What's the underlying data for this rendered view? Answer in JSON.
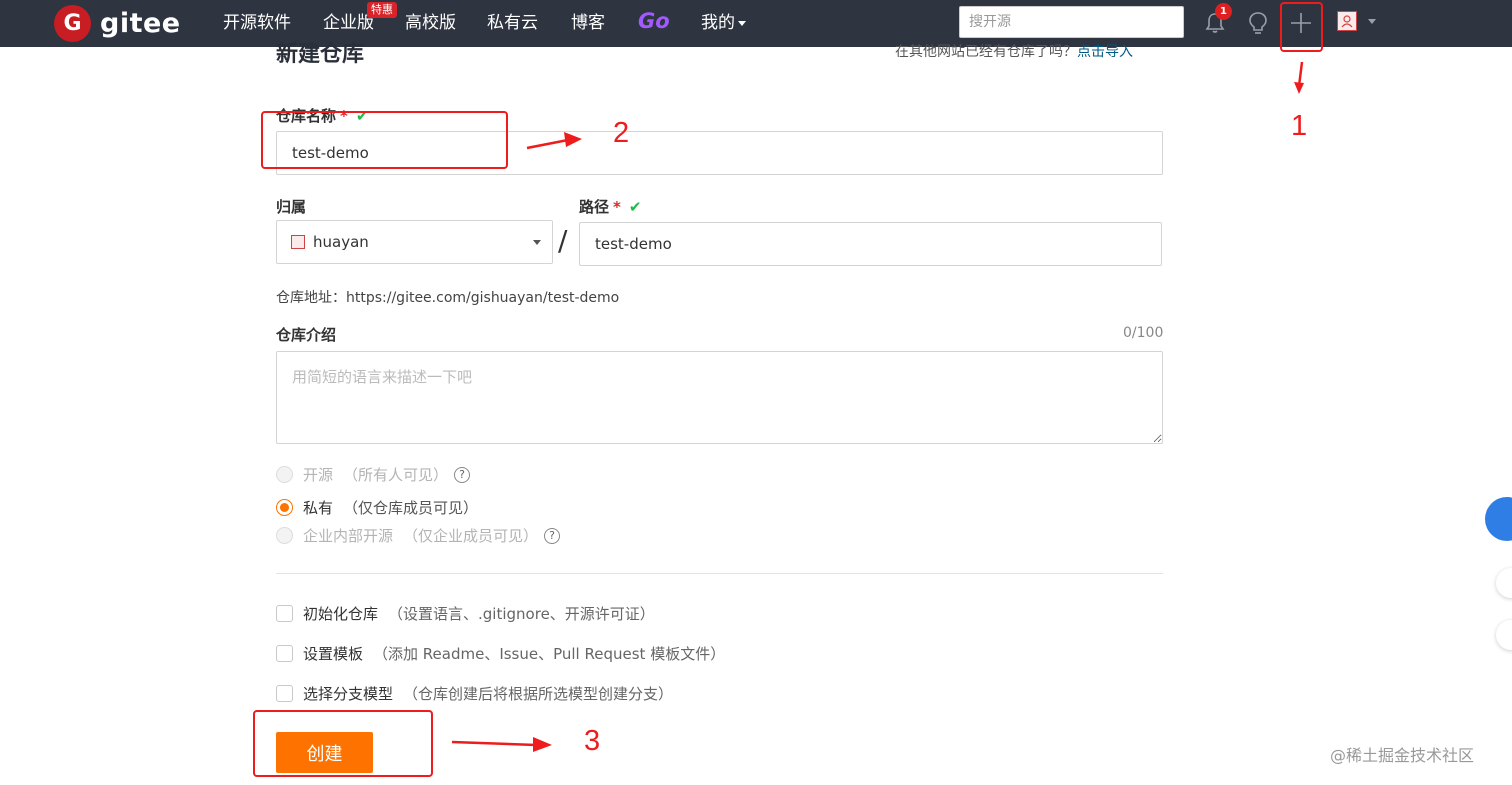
{
  "header": {
    "logo_letter": "G",
    "logo_text": "gitee",
    "nav": [
      {
        "label": "开源软件"
      },
      {
        "label": "企业版"
      },
      {
        "label": "高校版"
      },
      {
        "label": "私有云"
      },
      {
        "label": "博客"
      },
      {
        "label": "Go"
      },
      {
        "label": "我的"
      }
    ],
    "promo_badge": "特惠",
    "search_placeholder": "搜开源",
    "notification_count": "1",
    "icons": [
      "bell-icon",
      "lightbulb-icon",
      "plus-icon",
      "avatar"
    ]
  },
  "form": {
    "title": "新建仓库",
    "import_prompt": "在其他网站已经有仓库了吗？",
    "import_link": "点击导入",
    "repo_name_label": "仓库名称",
    "repo_name_value": "test-demo",
    "owner_label": "归属",
    "owner_value": "huayan",
    "path_label": "路径",
    "path_value": "test-demo",
    "required_mark": "*",
    "repo_url_label": "仓库地址：",
    "repo_url_value": "https://gitee.com/gishuayan/test-demo",
    "intro_label": "仓库介绍",
    "intro_counter": "0/100",
    "intro_placeholder": "用简短的语言来描述一下吧",
    "visibility": [
      {
        "label": "开源",
        "desc": "（所有人可见）",
        "selected": false,
        "disabled": true,
        "help": true
      },
      {
        "label": "私有",
        "desc": "（仅仓库成员可见）",
        "selected": true,
        "disabled": false,
        "help": false
      },
      {
        "label": "企业内部开源",
        "desc": "（仅企业成员可见）",
        "selected": false,
        "disabled": true,
        "help": true
      }
    ],
    "options": [
      {
        "label": "初始化仓库",
        "desc": "（设置语言、.gitignore、开源许可证）",
        "checked": false
      },
      {
        "label": "设置模板",
        "desc": "（添加 Readme、Issue、Pull Request 模板文件）",
        "checked": false
      },
      {
        "label": "选择分支模型",
        "desc": "（仓库创建后将根据所选模型创建分支）",
        "checked": false
      }
    ],
    "submit_label": "创建"
  },
  "annotations": {
    "step1": "1",
    "step2": "2",
    "step3": "3",
    "color": "#ee1c1c"
  },
  "watermark": "@稀土掘金技术社区",
  "colors": {
    "header_bg": "#2e3440",
    "brand": "#c71d23",
    "primary_button": "#fe7300",
    "valid_check": "#21ba45",
    "go_purple": "#a259ff"
  }
}
